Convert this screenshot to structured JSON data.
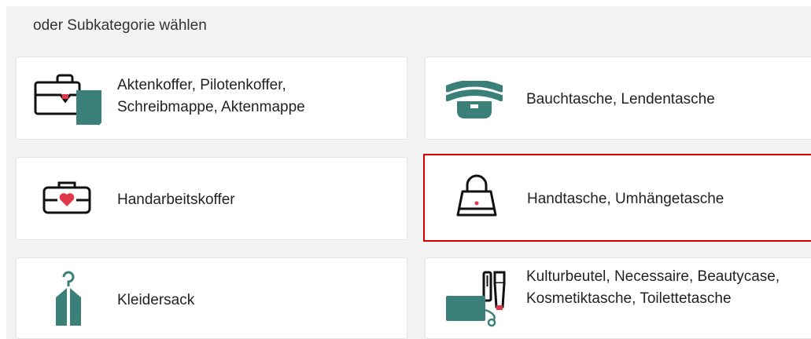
{
  "heading": "oder Subkategorie wählen",
  "colors": {
    "accent": "#3a7f78",
    "heart": "#e03a4a",
    "selection": "#d40000"
  },
  "categories": [
    {
      "label": "Aktenkoffer, Pilotenkoffer, Schreibmappe, Aktenmappe",
      "icon": "briefcase-icon",
      "selected": false
    },
    {
      "label": "Bauchtasche, Lendentasche",
      "icon": "belt-bag-icon",
      "selected": false
    },
    {
      "label": "Handarbeitskoffer",
      "icon": "sewing-case-icon",
      "selected": false
    },
    {
      "label": "Handtasche, Umhängetasche",
      "icon": "handbag-icon",
      "selected": true
    },
    {
      "label": "Kleidersack",
      "icon": "garment-bag-icon",
      "selected": false
    },
    {
      "label": "Kulturbeutel, Necessaire, Beautycase, Kosmetiktasche, Toilettetasche",
      "icon": "toiletry-bag-icon",
      "selected": false
    }
  ]
}
